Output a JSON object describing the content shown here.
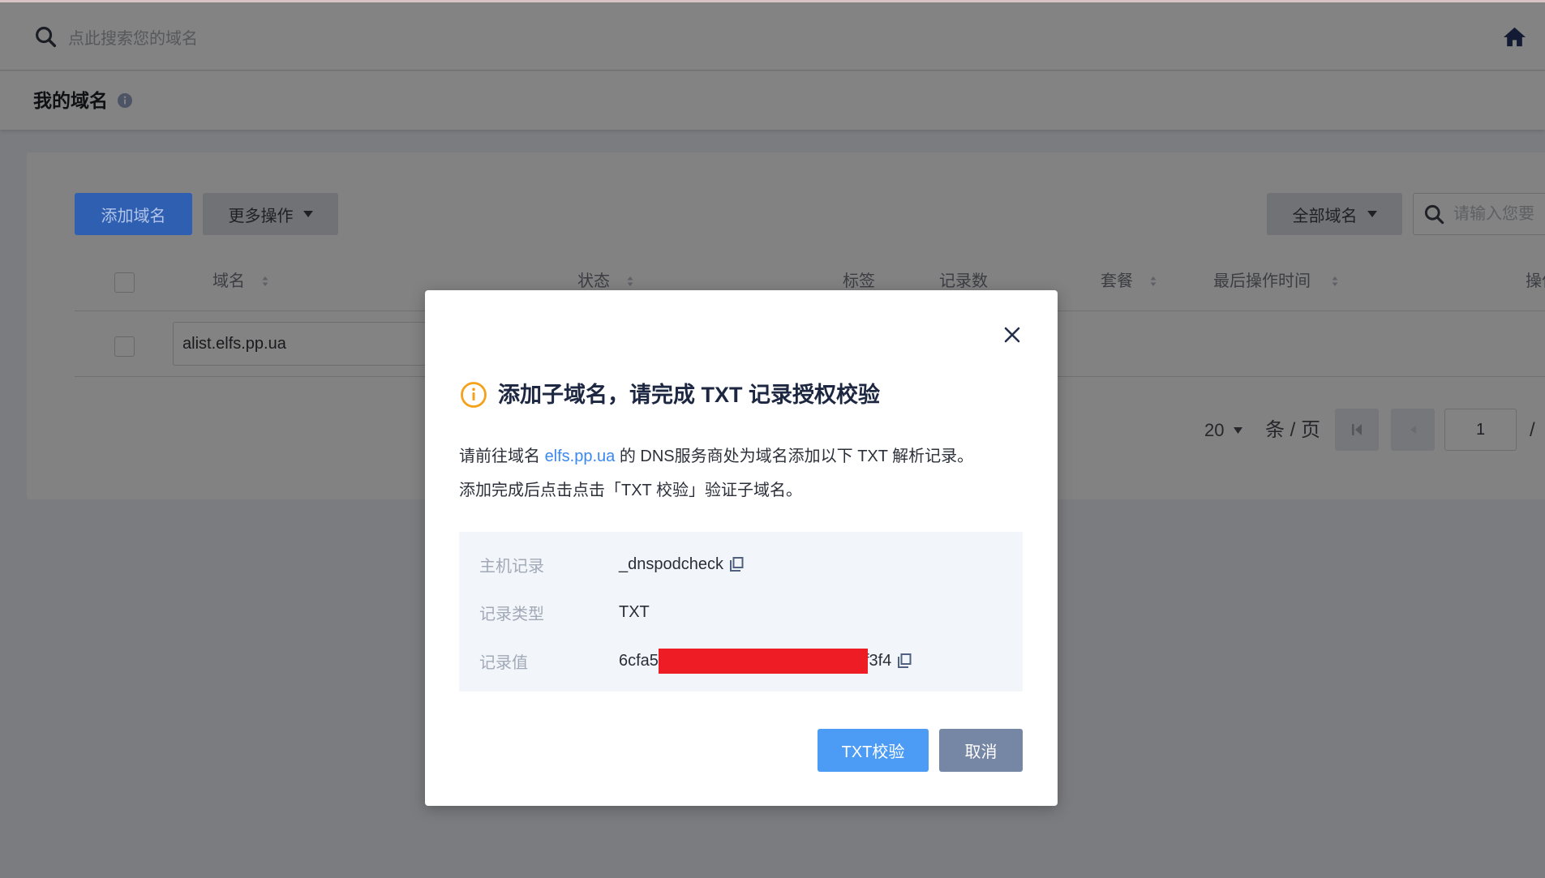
{
  "header": {
    "search_placeholder": "点此搜索您的域名",
    "search_icon": "search-icon",
    "home_icon": "home-icon"
  },
  "page": {
    "title": "我的域名",
    "info_icon": "info-icon"
  },
  "toolbar": {
    "add_domain": "添加域名",
    "more_actions": "更多操作",
    "domain_filter": "全部域名",
    "search_placeholder": "请输入您要"
  },
  "table": {
    "columns": [
      {
        "label": "域名",
        "sortable": true
      },
      {
        "label": "状态",
        "sortable": true
      },
      {
        "label": "标签",
        "sortable": false
      },
      {
        "label": "记录数",
        "sortable": false
      },
      {
        "label": "套餐",
        "sortable": true
      },
      {
        "label": "最后操作时间",
        "sortable": true
      },
      {
        "label": "操作",
        "sortable": false
      }
    ],
    "rows": [
      {
        "domain": "alist.elfs.pp.ua",
        "selected": false
      }
    ]
  },
  "pagination": {
    "page_size": "20",
    "per_page": "条 / 页",
    "current_page": "1",
    "page_separator": "/"
  },
  "modal": {
    "title": "添加子域名，请完成 TXT 记录授权校验",
    "desc_prefix": "请前往域名 ",
    "desc_link": "elfs.pp.ua",
    "desc_suffix": " 的 DNS服务商处为域名添加以下 TXT 解析记录。",
    "desc_line2": "添加完成后点击点击「TXT 校验」验证子域名。",
    "records": [
      {
        "label": "主机记录",
        "value": "_dnspodcheck",
        "copyable": true
      },
      {
        "label": "记录类型",
        "value": "TXT",
        "copyable": false
      },
      {
        "label": "记录值",
        "value_prefix": "6cfa5",
        "value_suffix": "f3f4",
        "redacted": true,
        "copyable": true
      }
    ],
    "confirm": "TXT校验",
    "cancel": "取消"
  },
  "colors": {
    "primary": "#4c9cf6",
    "link": "#3a88f0",
    "warning": "#f5a11c",
    "cancel": "#7686a5",
    "redaction": "#ee1c25",
    "record_box": "#f2f5fa"
  }
}
